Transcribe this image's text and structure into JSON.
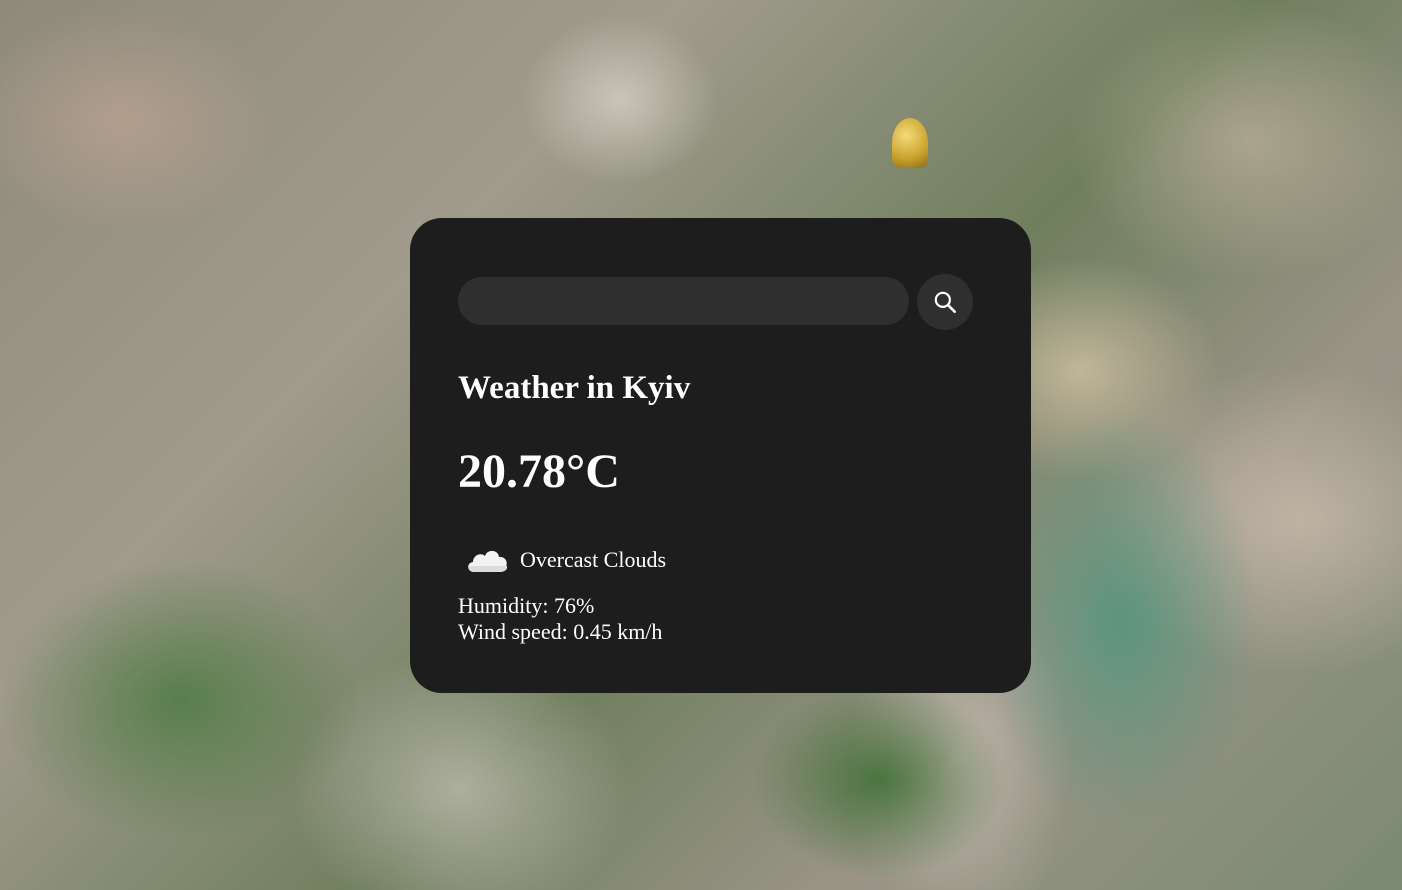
{
  "search": {
    "value": "",
    "placeholder": ""
  },
  "weather": {
    "title": "Weather in Kyiv",
    "temperature": "20.78°C",
    "condition": "Overcast Clouds",
    "condition_icon": "cloud-icon",
    "humidity_label": "Humidity: 76%",
    "wind_label": "Wind speed: 0.45 km/h"
  },
  "colors": {
    "card_background": "#1e1d1d",
    "input_background": "#302f2f",
    "text": "#ffffff"
  }
}
